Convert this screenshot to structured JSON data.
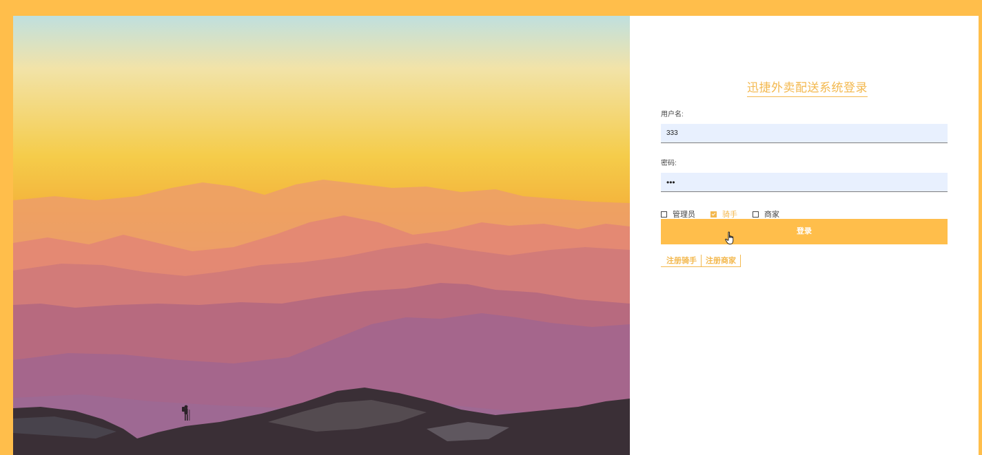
{
  "login": {
    "title": "迅捷外卖配送系统登录",
    "username_label": "用户名:",
    "username_value": "333",
    "password_label": "密码:",
    "password_value": "•••",
    "roles": [
      {
        "label": "管理员",
        "checked": false
      },
      {
        "label": "骑手",
        "checked": true
      },
      {
        "label": "商家",
        "checked": false
      }
    ],
    "submit_label": "登录",
    "register_links": [
      "注册骑手",
      "注册商家"
    ]
  },
  "colors": {
    "accent": "#ffbe4b",
    "title": "#f3b84e",
    "input_bg": "#e8f0fe"
  },
  "icons": {
    "cursor": "hand-pointer-icon",
    "checkbox_checked": "check-icon"
  }
}
